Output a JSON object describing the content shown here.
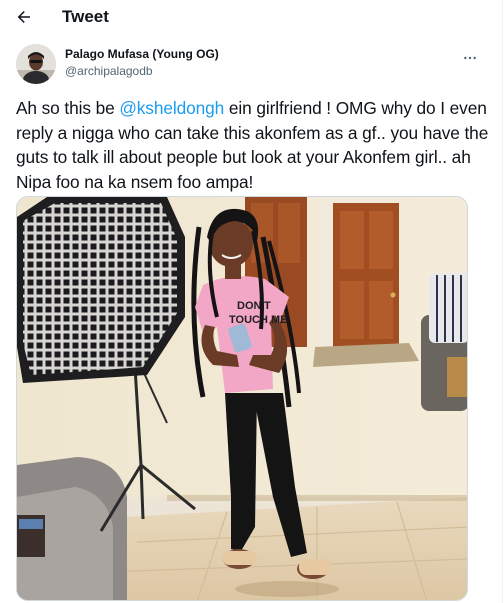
{
  "header": {
    "title": "Tweet",
    "back_icon": "arrow-left-icon"
  },
  "tweet": {
    "author": {
      "name": "Palago Mufasa (Young OG)",
      "handle": "@archipalagodb"
    },
    "more_icon": "more-horizontal-icon",
    "text": {
      "before_mention": "Ah so this be ",
      "mention": "@ksheldongh",
      "after_mention": " ein girlfriend ! OMG why do I even reply a nigga who can take this akonfem as a gf.. you have the guts to talk ill about people but look at your Akonfem girl.. ah Nipa foo na ka nsem foo ampa!"
    },
    "media": {
      "shirt_text_line1": "DON'T",
      "shirt_text_line2": "TOUCH ME"
    }
  },
  "colors": {
    "accent": "#1d9bf0",
    "text_primary": "#0f1419",
    "text_secondary": "#536471"
  }
}
